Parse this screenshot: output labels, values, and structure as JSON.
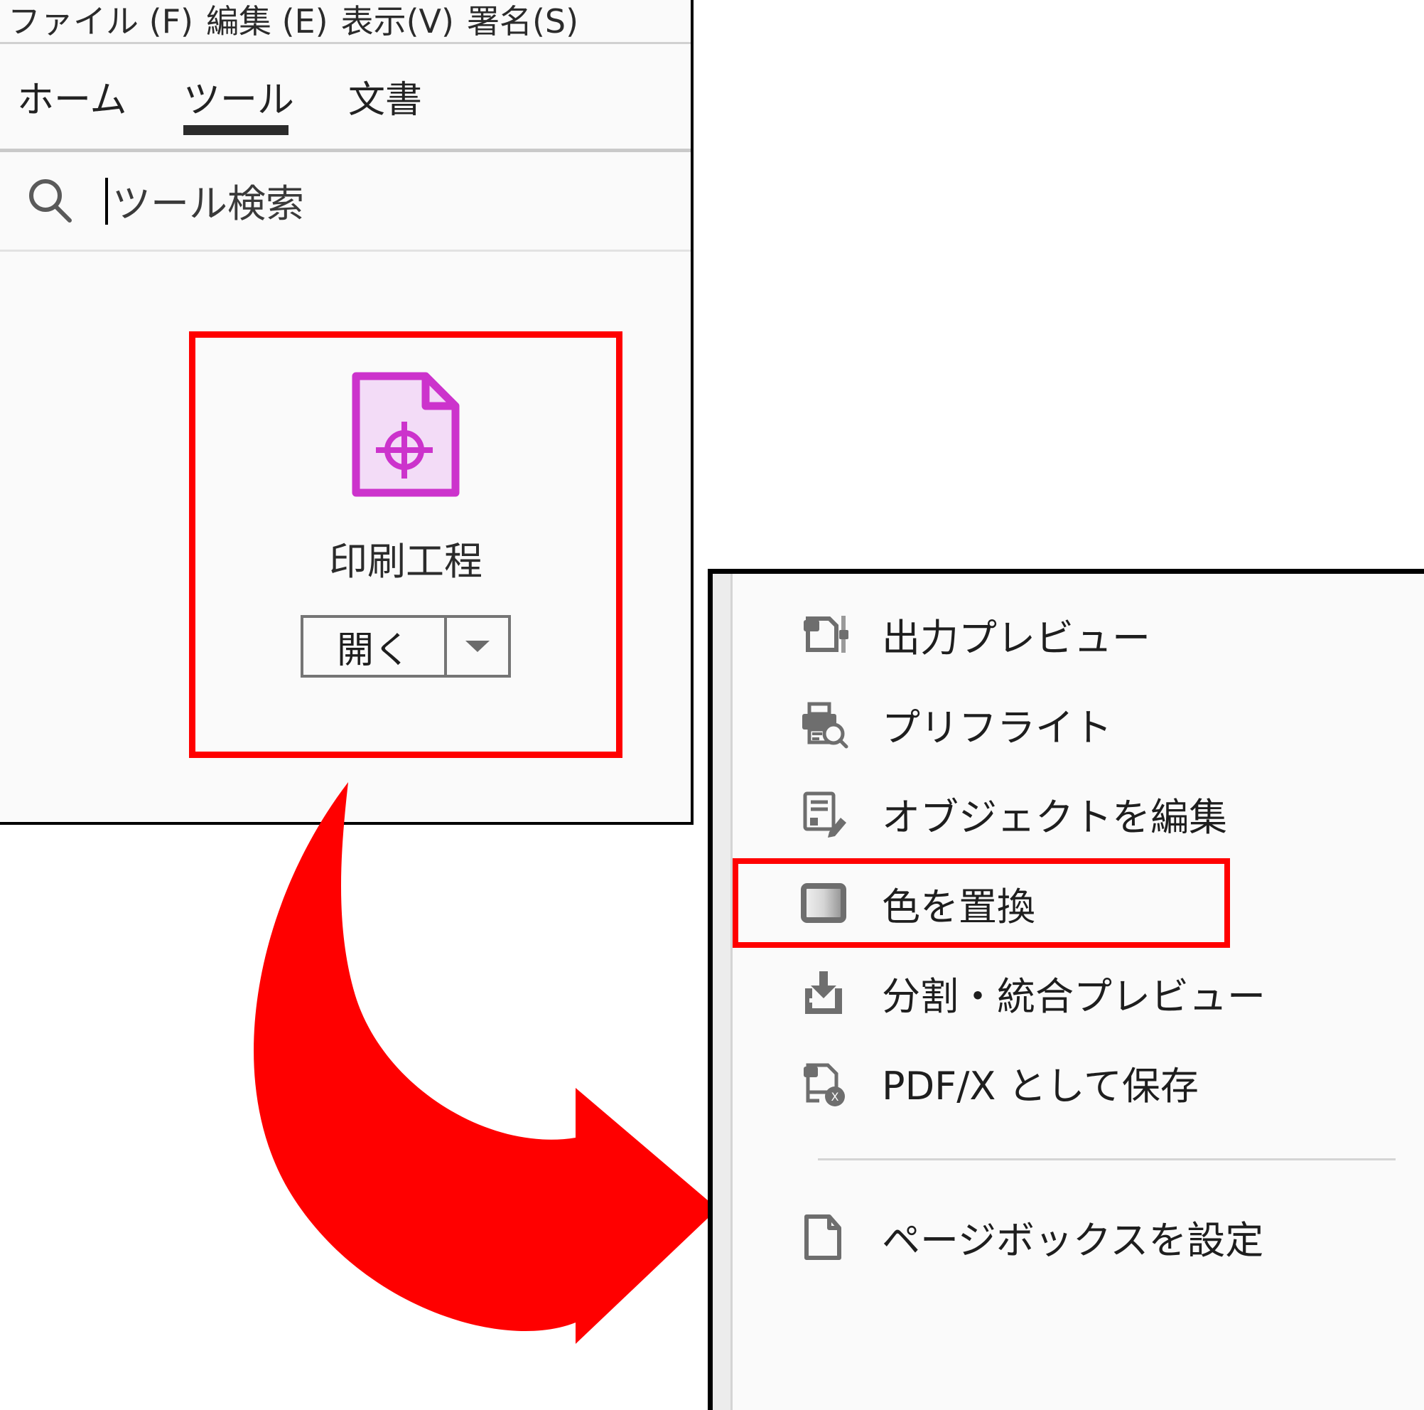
{
  "app": {
    "menubar": [
      {
        "name": "file-menu",
        "label": "ファイル (F)"
      },
      {
        "name": "edit-menu",
        "label": "編集 (E)"
      },
      {
        "name": "view-menu",
        "label": "表示(V)"
      },
      {
        "name": "sign-menu",
        "label": "署名(S)"
      }
    ],
    "tabs": [
      {
        "name": "tab-home",
        "label": "ホーム",
        "active": false
      },
      {
        "name": "tab-tools",
        "label": "ツール",
        "active": true
      },
      {
        "name": "tab-docs",
        "label": "文書",
        "active": false
      }
    ],
    "search": {
      "icon": "search-icon",
      "value": "",
      "placeholder": "ツール検索"
    },
    "tool_card": {
      "icon": "print-production-document-icon",
      "label": "印刷工程",
      "open_button": "開く",
      "dropdown_icon": "chevron-down-icon",
      "highlight_color": "#ff0000"
    }
  },
  "annotation": {
    "arrow": {
      "name": "red-curved-arrow",
      "color": "#ff0000",
      "direction": "down-right"
    }
  },
  "flyout_menu": {
    "items": [
      {
        "name": "menu-item-output-preview",
        "icon": "document-slider-icon",
        "label": "出力プレビュー",
        "highlighted": false
      },
      {
        "name": "menu-item-preflight",
        "icon": "printer-magnifier-icon",
        "label": "プリフライト",
        "highlighted": false
      },
      {
        "name": "menu-item-edit-object",
        "icon": "document-pencil-icon",
        "label": "オブジェクトを編集",
        "highlighted": false
      },
      {
        "name": "menu-item-replace-color",
        "icon": "color-swatch-icon",
        "label": "色を置換",
        "highlighted": true
      },
      {
        "name": "menu-item-flattener-preview",
        "icon": "flatten-arrow-icon",
        "label": "分割・統合プレビュー",
        "highlighted": false
      },
      {
        "name": "menu-item-save-as-pdfx",
        "icon": "pdfx-save-icon",
        "label": "PDF/X として保存",
        "highlighted": false
      },
      {
        "name": "menu-item-set-page-boxes",
        "icon": "page-box-icon",
        "label": "ページボックスを設定",
        "highlighted": false
      }
    ],
    "highlight_color": "#ff0000"
  },
  "colors": {
    "highlight": "#ff0000",
    "tool_icon_stroke": "#cc33cc",
    "tool_icon_fill": "#f0d6f5",
    "menu_icon": "#6e6e6e",
    "panel_bg": "#fafafa"
  }
}
